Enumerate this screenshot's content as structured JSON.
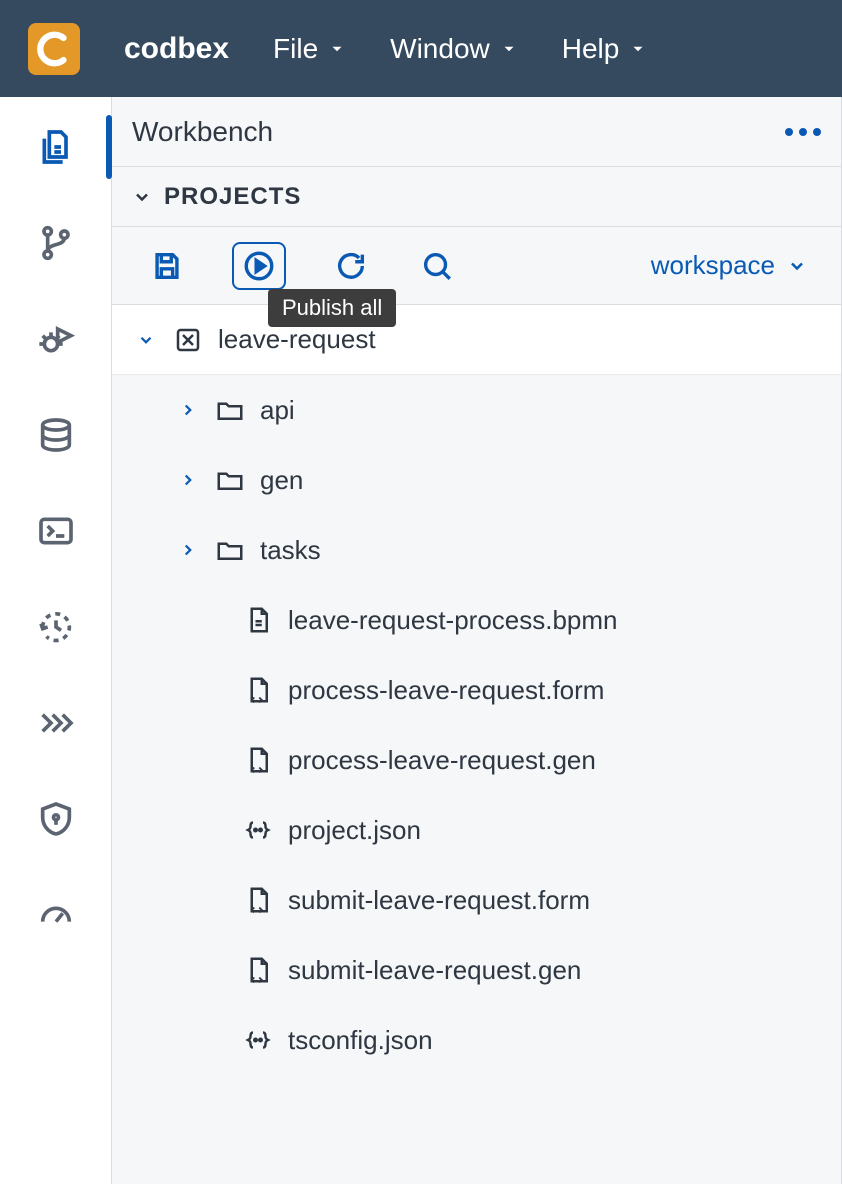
{
  "brand": "codbex",
  "menu": {
    "file": "File",
    "window": "Window",
    "help": "Help"
  },
  "panel": {
    "title": "Workbench"
  },
  "section": {
    "projects": "PROJECTS"
  },
  "toolbar": {
    "workspace": "workspace",
    "tooltip": "Publish all"
  },
  "tree": {
    "root": "leave-request",
    "folders": {
      "api": "api",
      "gen": "gen",
      "tasks": "tasks"
    },
    "files": {
      "f1": "leave-request-process.bpmn",
      "f2": "process-leave-request.form",
      "f3": "process-leave-request.gen",
      "f4": "project.json",
      "f5": "submit-leave-request.form",
      "f6": "submit-leave-request.gen",
      "f7": "tsconfig.json"
    }
  }
}
